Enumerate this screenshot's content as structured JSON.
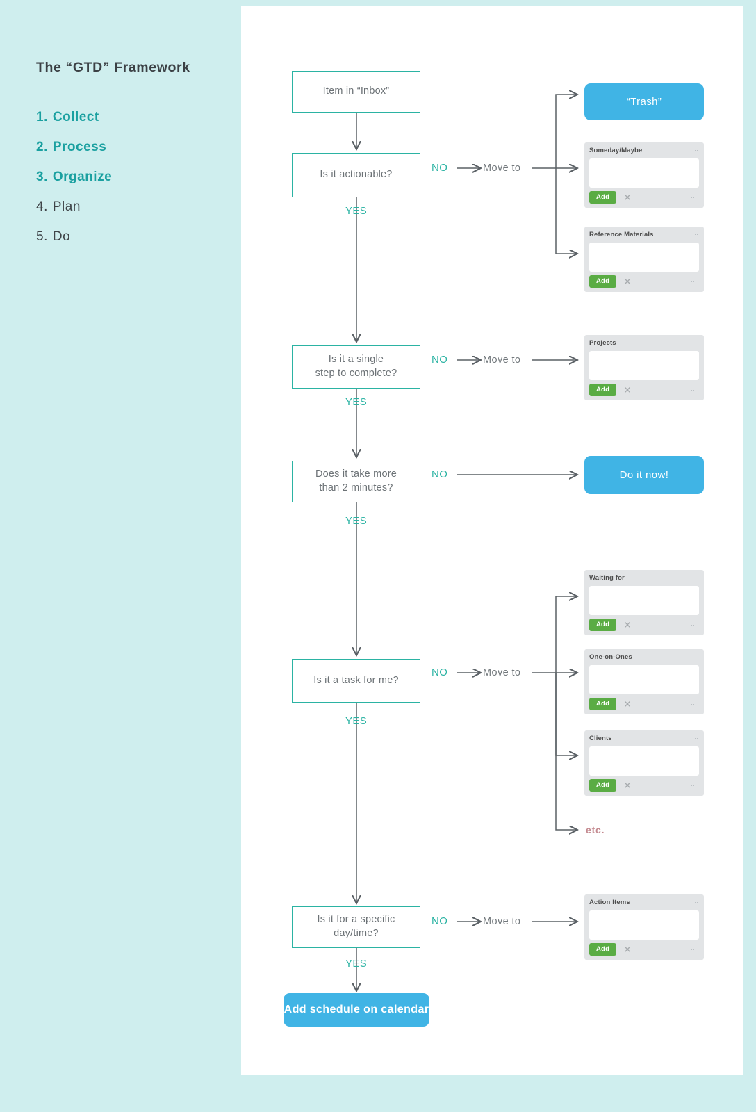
{
  "sidebar": {
    "title": "The “GTD” Framework",
    "items": [
      {
        "num": "1.",
        "label": "Collect",
        "active": true
      },
      {
        "num": "2.",
        "label": "Process",
        "active": true
      },
      {
        "num": "3.",
        "label": "Organize",
        "active": true
      },
      {
        "num": "4.",
        "label": "Plan",
        "active": false
      },
      {
        "num": "5.",
        "label": "Do",
        "active": false
      }
    ]
  },
  "flow": {
    "nodes": {
      "inbox": "Item in “Inbox”",
      "actionable": "Is it actionable?",
      "single": "Is it a single\nstep to complete?",
      "twomin": "Does it take more\nthan 2 minutes?",
      "taskforme": "Is it a task for me?",
      "specific": "Is it for a specific\nday/time?"
    },
    "pills": {
      "trash": "“Trash”",
      "doitnow": "Do it now!",
      "calendar": "Add schedule on calendar"
    },
    "labels": {
      "no": "NO",
      "yes": "YES",
      "move_to": "Move to",
      "etc": "etc."
    }
  },
  "cards": {
    "add_label": "Add",
    "close_icon": "✕",
    "menu_icon": "⋯",
    "list": [
      {
        "title": "Someday/Maybe"
      },
      {
        "title": "Reference Materials"
      },
      {
        "title": "Projects"
      },
      {
        "title": "Waiting for"
      },
      {
        "title": "One-on-Ones"
      },
      {
        "title": "Clients"
      },
      {
        "title": "Action Items"
      }
    ]
  },
  "colors": {
    "sidebar_bg": "#cfeeee",
    "teal": "#2bb3a3",
    "blue_pill": "#40b4e5",
    "green_add": "#5aac44",
    "card_bg": "#e2e4e6",
    "etc_pink": "#c4898f",
    "wire": "#5a6065"
  }
}
